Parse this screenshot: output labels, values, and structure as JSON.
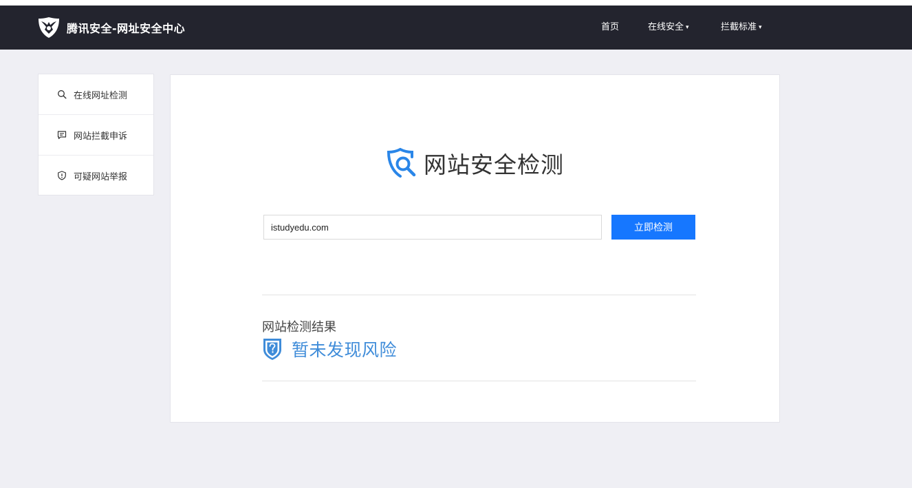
{
  "header": {
    "brand": "腾讯安全-网址安全中心",
    "nav": [
      {
        "label": "首页",
        "has_dropdown": false
      },
      {
        "label": "在线安全",
        "has_dropdown": true
      },
      {
        "label": "拦截标准",
        "has_dropdown": true
      }
    ],
    "caret": "▾",
    "bg_color": "#23242e"
  },
  "sidebar": {
    "items": [
      {
        "label": "在线网址检测",
        "icon": "search-icon"
      },
      {
        "label": "网站拦截申诉",
        "icon": "message-icon"
      },
      {
        "label": "可疑网站举报",
        "icon": "shield-alert-icon"
      }
    ]
  },
  "main": {
    "title": "网站安全检测",
    "title_icon": "shield-search-icon",
    "input_value": "istudyedu.com",
    "button_label": "立即检测",
    "button_color": "#1677ff",
    "result_label": "网站检测结果",
    "result_text": "暂未发现风险",
    "result_icon": "shield-question-icon",
    "result_color": "#3f8cd9"
  }
}
